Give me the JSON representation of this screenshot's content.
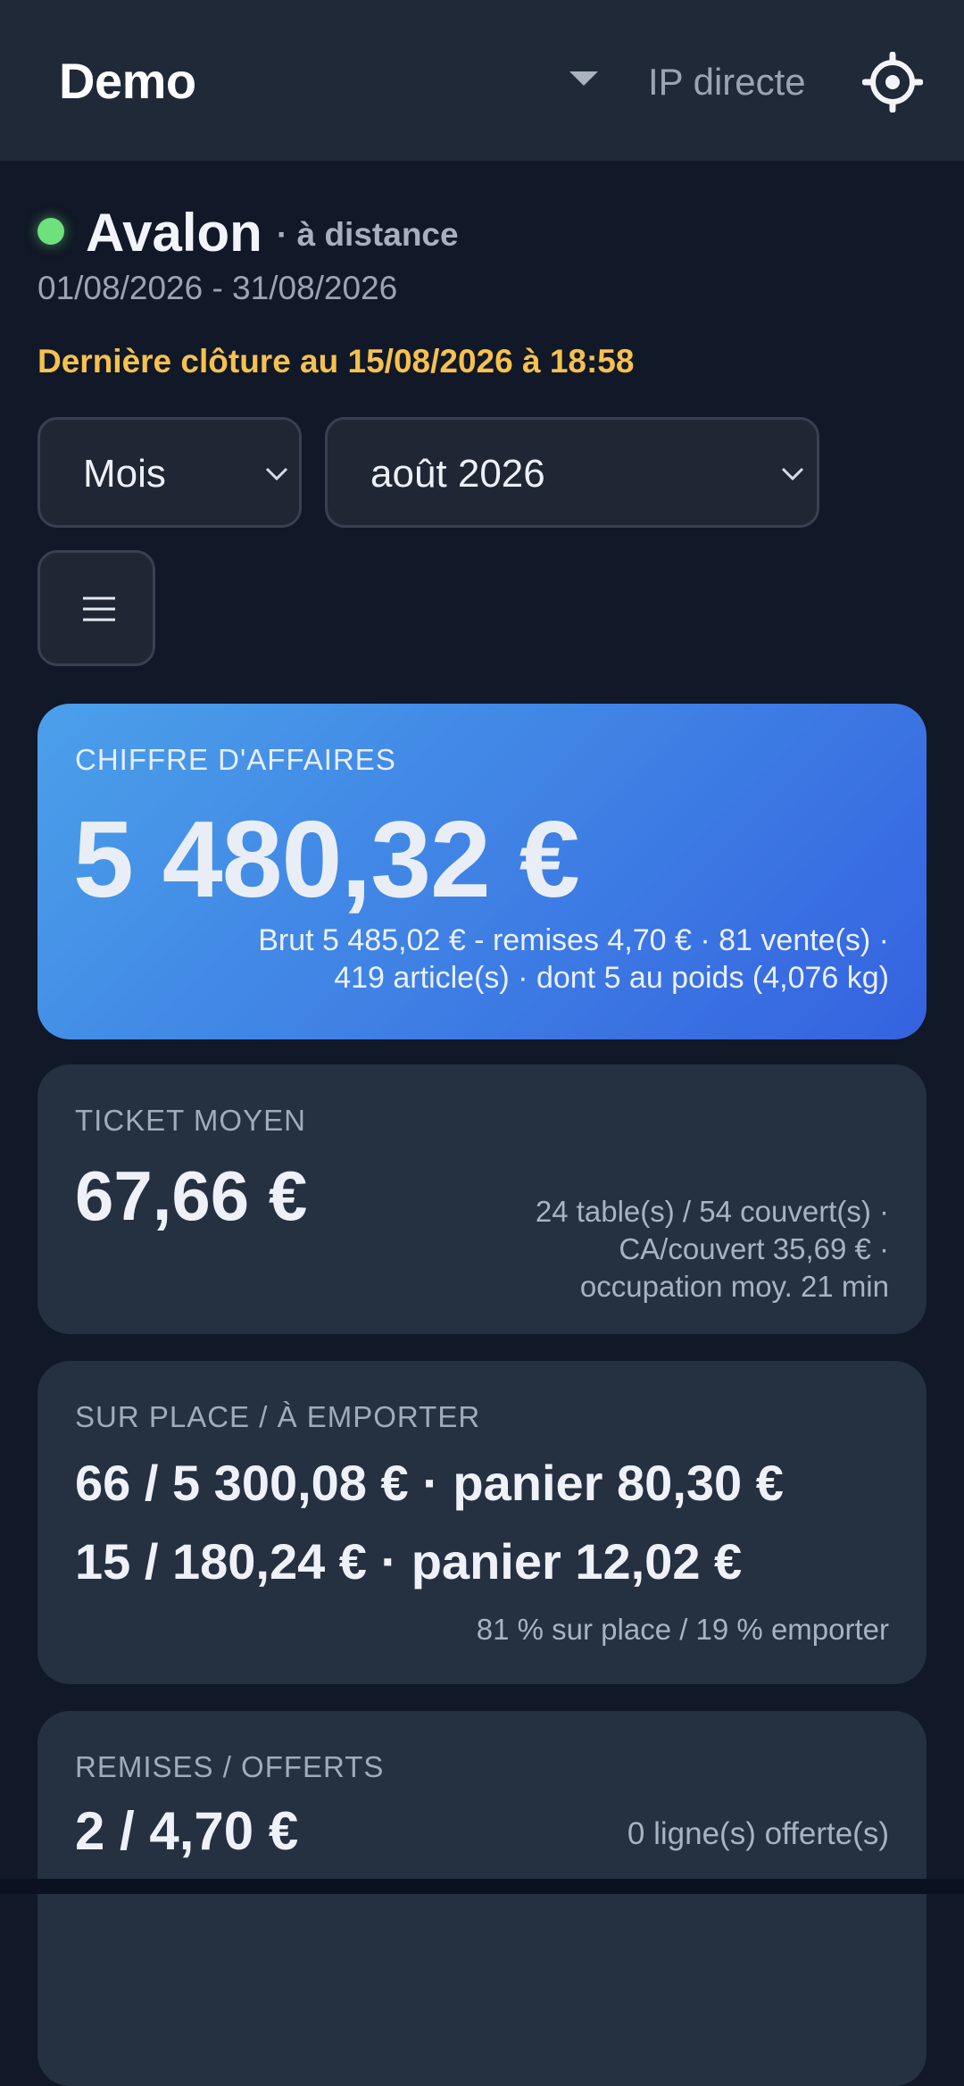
{
  "header": {
    "brand": "Demo",
    "connection_mode": "IP directe",
    "icons": {
      "mode_dropdown": "caret-down-icon",
      "settings": "settings-gear-icon"
    }
  },
  "shop": {
    "name": "Avalon",
    "mode": "· à distance",
    "status_color": "#6ee07e",
    "period": "01/08/2026 - 31/08/2026",
    "last_closure": "Dernière clôture au 15/08/2026 à 18:58"
  },
  "filters": {
    "granularity": "Mois",
    "month": "août 2026",
    "menu_icon": "hamburger-menu-icon"
  },
  "cards": {
    "revenue": {
      "caption": "CHIFFRE D'AFFAIRES",
      "value": "5 480,32 €",
      "detail_line1": "Brut 5 485,02 € - remises 4,70 € · 81 vente(s) ·",
      "detail_line2": "419 article(s) · dont 5 au poids (4,076 kg)",
      "accent_from": "#4ba0ea",
      "accent_to": "#3562e0"
    },
    "average_ticket": {
      "caption": "TICKET MOYEN",
      "value": "67,66 €",
      "detail_line1": "24 table(s) / 54 couvert(s) ·",
      "detail_line2": "CA/couvert 35,69 € ·",
      "detail_line3": "occupation moy. 21 min"
    },
    "dine_in_takeaway": {
      "caption": "SUR PLACE / À EMPORTER",
      "line1": "66 / 5 300,08 € · panier 80,30 €",
      "line2": "15 / 180,24 € · panier 12,02 €",
      "detail": "81 % sur place / 19 % emporter"
    },
    "discounts": {
      "caption": "REMISES / OFFERTS",
      "value": "2 / 4,70 €",
      "detail": "0 ligne(s) offerte(s)"
    }
  }
}
